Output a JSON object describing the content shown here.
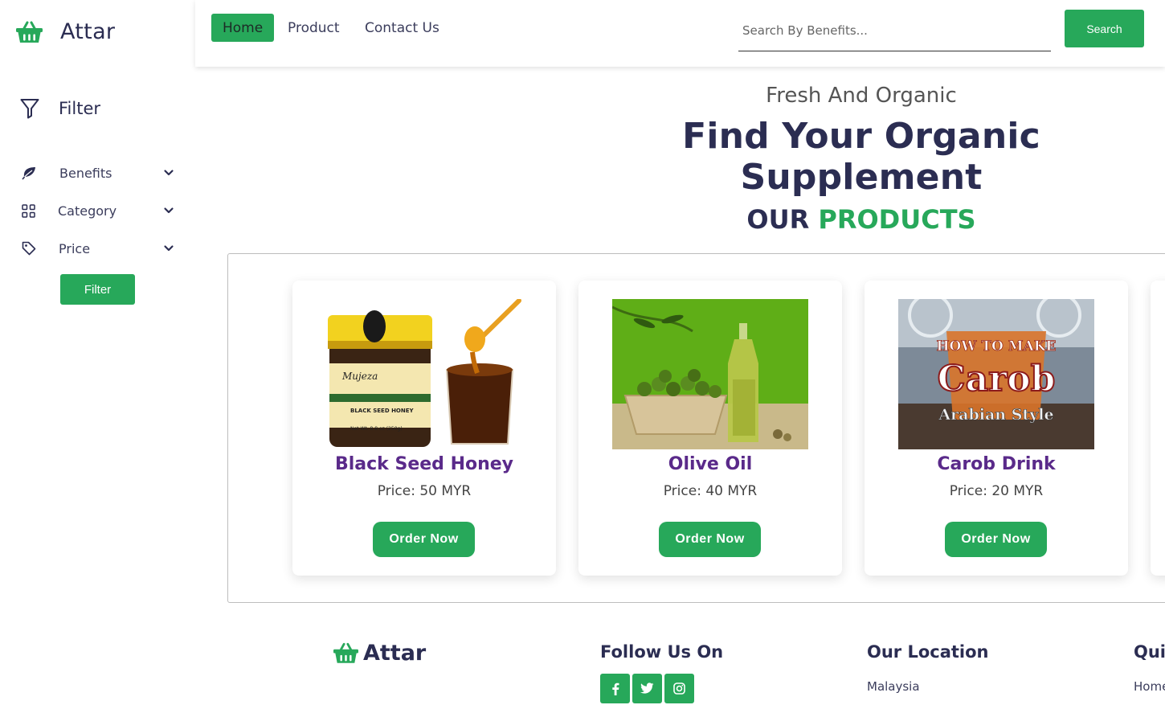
{
  "brand": {
    "name": "Attar",
    "icon": "basket-icon"
  },
  "colors": {
    "accent": "#27a85a",
    "primary_text": "#2b2d52",
    "product_name": "#5a2a8a"
  },
  "sidebar": {
    "filter_title": "Filter",
    "items": [
      {
        "label": "Benefits",
        "icon": "leaf-icon"
      },
      {
        "label": "Category",
        "icon": "grid-icon"
      },
      {
        "label": "Price",
        "icon": "tag-icon"
      }
    ],
    "filter_button": "Filter"
  },
  "nav": {
    "links": [
      {
        "label": "Home",
        "active": true
      },
      {
        "label": "Product",
        "active": false
      },
      {
        "label": "Contact Us",
        "active": false
      }
    ],
    "search_placeholder": "Search By Benefits...",
    "search_button": "Search"
  },
  "hero": {
    "subtitle": "Fresh And Organic",
    "title": "Find Your Organic Supplement"
  },
  "products_section": {
    "title_part1": "OUR",
    "title_part2": "PRODUCTS",
    "items": [
      {
        "name": "Black Seed Honey",
        "price": "Price: 50 MYR",
        "button": "Order Now"
      },
      {
        "name": "Olive Oil",
        "price": "Price: 40 MYR",
        "button": "Order Now"
      },
      {
        "name": "Carob Drink",
        "price": "Price: 20 MYR",
        "button": "Order Now"
      }
    ],
    "carob_image_text": {
      "line1": "HOW TO MAKE",
      "line2": "Carob",
      "line3": "Arabian Style"
    },
    "honey_image_text": {
      "line1": "BLACK SEED HONEY",
      "line2": "Net Wt. 8.8 oz (250g)"
    }
  },
  "footer": {
    "brand": "Attar",
    "follow_title": "Follow Us On",
    "social": [
      "facebook-icon",
      "twitter-icon",
      "instagram-icon"
    ],
    "location_title": "Our Location",
    "location_value": "Malaysia",
    "quick_title": "Quick Links",
    "quick_first": "Home"
  }
}
